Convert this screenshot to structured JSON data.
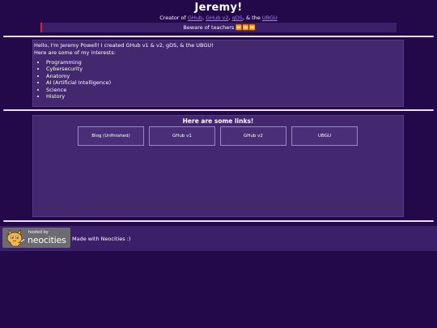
{
  "header": {
    "title": "Jeremy!",
    "creator_prefix": "Creator of ",
    "links": [
      "GHub",
      "GHub v2",
      "gDS",
      "UBGU"
    ],
    "sep1": ", ",
    "sep2": ", ",
    "sep3": ", & the ",
    "notice": "Beware of teachers ⏩⏩⏩"
  },
  "intro": {
    "line1": "Hello, I'm Jeremy Powell! I created GHub v1 & v2, gDS, & the UBGU!",
    "line2": "Here are some of my interests:",
    "interests": [
      "Programming",
      "Cybersecurity",
      "Anatomy",
      "AI (Artificial Intelligence)",
      "Science",
      "History"
    ]
  },
  "links_section": {
    "title": "Here are some links!",
    "buttons": [
      "Blog (Unfinished)",
      "GHub v1",
      "GHub v2",
      "UBGU"
    ]
  },
  "footer": {
    "badge_hosted": "hosted by",
    "badge_brand": "neocities",
    "made_with": "Made with Neocities :)"
  },
  "colors": {
    "background": "#23094a",
    "panel": "#44286f",
    "link": "#b07cff",
    "notice_accent": "#d8243a"
  }
}
